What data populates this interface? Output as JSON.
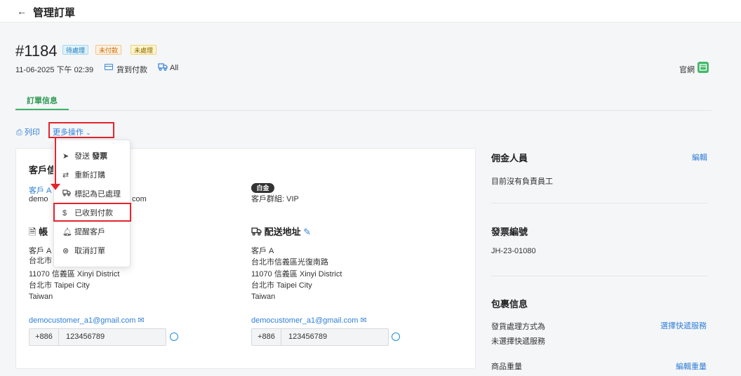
{
  "header": {
    "back_icon": "arrow-left-icon",
    "title": "管理訂單"
  },
  "order": {
    "number": "#1184",
    "badges": [
      "待處理",
      "未付款",
      "未處理"
    ],
    "datetime": "11-06-2025 下午 02:39",
    "payment_method": "貨到付款",
    "shipping": "All",
    "channel": "官網"
  },
  "tabs": [
    {
      "label": "訂單信息"
    }
  ],
  "actions": {
    "print": "列印",
    "more": "更多操作"
  },
  "dropdown": {
    "items": [
      {
        "label_prefix": "發送 ",
        "label_bold": "發票",
        "icon": "send-icon"
      },
      {
        "label": "重新訂購",
        "icon": "repeat-icon"
      },
      {
        "label": "標記為已處理",
        "icon": "truck-icon"
      },
      {
        "label": "已收到付款",
        "icon": "dollar-icon"
      },
      {
        "label": "提醒客戶",
        "icon": "bell-icon"
      },
      {
        "label": "取消訂單",
        "icon": "cancel-circle-icon"
      }
    ]
  },
  "customer": {
    "section_title_visible": "客戶信",
    "name_link": "客戶 A",
    "email_visible_start": "demo",
    "email_visible_end": "com",
    "tier": "白金",
    "group": "客戶群組: VIP"
  },
  "billing": {
    "title_visible": "帳",
    "name": "客戶 A",
    "line1_visible": "台北市",
    "line2": "11070 信義區 Xinyi District",
    "line3": "台北市 Taipei City",
    "line4": "Taiwan",
    "email": "democustomer_a1@gmail.com",
    "phone_cc": "+886",
    "phone": "123456789"
  },
  "shipping_address": {
    "title": "配送地址",
    "name": "客戶 A",
    "line1": "台北市信義區光復南路",
    "line2": "11070 信義區 Xinyi District",
    "line3": "台北市 Taipei City",
    "line4": "Taiwan",
    "email": "democustomer_a1@gmail.com",
    "phone_cc": "+886",
    "phone": "123456789"
  },
  "side": {
    "commission": {
      "title": "佣金人員",
      "edit": "編輯",
      "empty": "目前沒有負責員工"
    },
    "invoice": {
      "title": "發票編號",
      "value": "JH-23-01080"
    },
    "package": {
      "title": "包裹信息",
      "ship_label": "發貨處理方式為",
      "ship_value": "未選擇快遞服務",
      "ship_link": "選擇快遞服務",
      "weight_label": "商品重量",
      "weight_link": "編輯重量"
    }
  },
  "colors": {
    "accent": "#2f7fd6",
    "green": "#3fb26a",
    "highlight": "#e4242c"
  }
}
